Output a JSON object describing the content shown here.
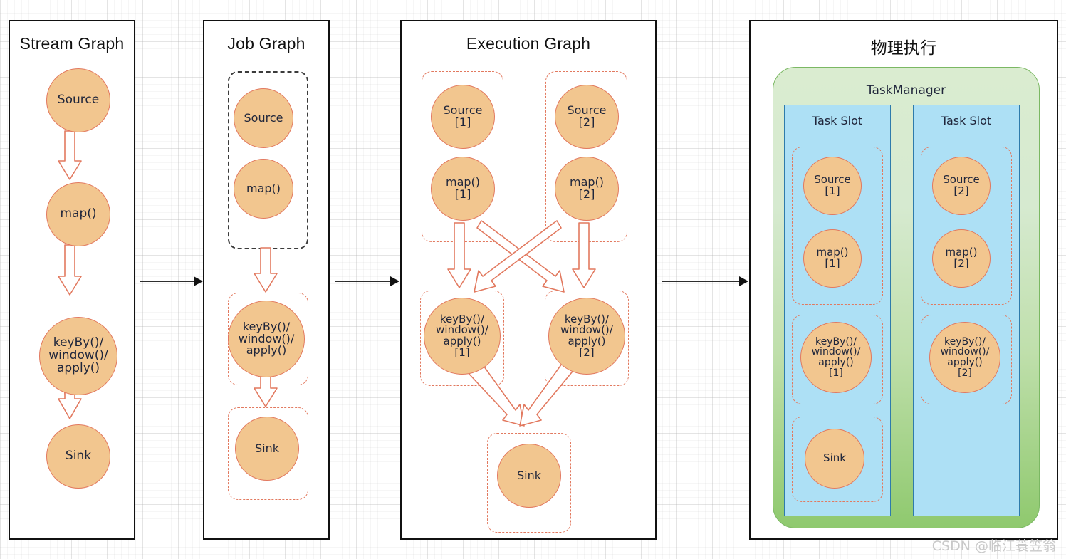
{
  "panels": [
    {
      "id": "stream-graph",
      "title": "Stream Graph"
    },
    {
      "id": "job-graph",
      "title": "Job Graph"
    },
    {
      "id": "execution-graph",
      "title": "Execution Graph"
    },
    {
      "id": "physical",
      "title": "物理执行"
    }
  ],
  "stream_graph": {
    "nodes": [
      {
        "label": "Source"
      },
      {
        "label": "map()"
      },
      {
        "label": "keyBy()/\nwindow()/\napply()"
      },
      {
        "label": "Sink"
      }
    ]
  },
  "job_graph": {
    "groups": [
      {
        "style": "black-dashed",
        "nodes": [
          {
            "label": "Source"
          },
          {
            "label": "map()"
          }
        ]
      },
      {
        "style": "orange-dashed",
        "nodes": [
          {
            "label": "keyBy()/\nwindow()/\napply()"
          }
        ]
      },
      {
        "style": "orange-dashed",
        "nodes": [
          {
            "label": "Sink"
          }
        ]
      }
    ]
  },
  "execution_graph": {
    "groups": [
      {
        "nodes": [
          {
            "label": "Source\n[1]"
          },
          {
            "label": "map()\n[1]"
          }
        ]
      },
      {
        "nodes": [
          {
            "label": "Source\n[2]"
          },
          {
            "label": "map()\n[2]"
          }
        ]
      },
      {
        "nodes": [
          {
            "label": "keyBy()/\nwindow()/\napply()\n[1]"
          }
        ]
      },
      {
        "nodes": [
          {
            "label": "keyBy()/\nwindow()/\napply()\n[2]"
          }
        ]
      },
      {
        "nodes": [
          {
            "label": "Sink"
          }
        ]
      }
    ]
  },
  "physical": {
    "taskmanager_label": "TaskManager",
    "slots": [
      {
        "title": "Task Slot",
        "groups": [
          {
            "nodes": [
              {
                "label": "Source\n[1]"
              },
              {
                "label": "map()\n[1]"
              }
            ]
          },
          {
            "nodes": [
              {
                "label": "keyBy()/\nwindow()/\napply()\n[1]"
              }
            ]
          },
          {
            "nodes": [
              {
                "label": "Sink"
              }
            ]
          }
        ]
      },
      {
        "title": "Task Slot",
        "groups": [
          {
            "nodes": [
              {
                "label": "Source\n[2]"
              },
              {
                "label": "map()\n[2]"
              }
            ]
          },
          {
            "nodes": [
              {
                "label": "keyBy()/\nwindow()/\napply()\n[2]"
              }
            ]
          }
        ]
      }
    ]
  },
  "watermark": {
    "text": "CSDN @临江蓑笠翁"
  },
  "colors": {
    "node_fill": "#f2c68f",
    "node_stroke": "#e2795f",
    "arrow_stroke": "#e2795f",
    "group_dashed": "#e2795f",
    "group_dashed_black": "#3b3b3b",
    "taskmanager_green": "#8fc96e",
    "taskslot_blue": "#ade0f5",
    "taskslot_border": "#2e7bab",
    "panel_border": "#111111",
    "flow_arrow": "#111111",
    "watermark": "#c9c9c9"
  }
}
